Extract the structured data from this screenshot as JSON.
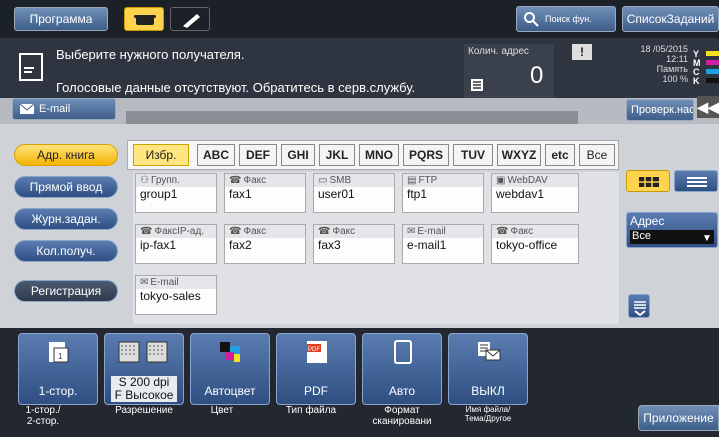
{
  "header": {
    "program": "Программа",
    "search": "Поиск фун.",
    "joblist": "СписокЗаданий"
  },
  "message": {
    "line1": "Выберите нужного получателя.",
    "line2": "Голосовые данные отсутствуют. Обратитесь в серв.службу.",
    "count_label": "Колич. адрес",
    "count_value": "0"
  },
  "status": {
    "date": "18 /05/2015",
    "time": "12:11",
    "memory_label": "Память",
    "memory_value": "100 %",
    "toner": [
      "Y",
      "M",
      "C",
      "K"
    ]
  },
  "destination": {
    "type": "E-mail",
    "check": "Проверк.наст.",
    "value": ""
  },
  "sidebar": {
    "items": [
      "Адр. книга",
      "Прямой ввод",
      "Журн.задан.",
      "Кол.получ.",
      "Регистрация"
    ]
  },
  "tabs": [
    "Избр.",
    "ABC",
    "DEF",
    "GHI",
    "JKL",
    "MNO",
    "PQRS",
    "TUV",
    "WXYZ",
    "etc",
    "Все"
  ],
  "cards": [
    {
      "type": "Групп.",
      "name": "group1"
    },
    {
      "type": "Факс",
      "name": "fax1"
    },
    {
      "type": "SMB",
      "name": "user01"
    },
    {
      "type": "FTP",
      "name": "ftp1"
    },
    {
      "type": "WebDAV",
      "name": "webdav1"
    },
    {
      "type": "ФаксIP-ад.",
      "name": "ip-fax1"
    },
    {
      "type": "Факс",
      "name": "fax2"
    },
    {
      "type": "Факс",
      "name": "fax3"
    },
    {
      "type": "E-mail",
      "name": "e-mail1"
    },
    {
      "type": "Факс",
      "name": "tokyo-office"
    },
    {
      "type": "E-mail",
      "name": "tokyo-sales"
    }
  ],
  "address": {
    "label": "Адрес",
    "value": "Все"
  },
  "functions": [
    {
      "label": "1-стор.",
      "caption": "1-стор./\n2-стор."
    },
    {
      "label": "S 200 dpi\nF Высокое",
      "caption": "Разрешение"
    },
    {
      "label": "Автоцвет",
      "caption": "Цвет"
    },
    {
      "label": "PDF",
      "caption": "Тип файла"
    },
    {
      "label": "Авто",
      "caption": "Формат\nсканировани"
    },
    {
      "label": "ВЫКЛ",
      "caption": "Имя файла/\nТема/Другое"
    }
  ],
  "app_button": "Приложение"
}
